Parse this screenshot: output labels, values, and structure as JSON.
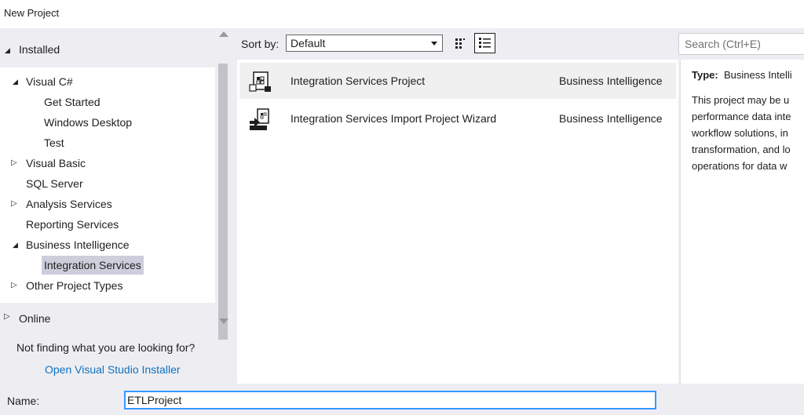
{
  "window": {
    "title": "New Project"
  },
  "tree": {
    "installed_label": "Installed",
    "items": [
      {
        "label": "Visual C#",
        "expanded": true
      },
      {
        "label": "Get Started"
      },
      {
        "label": "Windows Desktop"
      },
      {
        "label": "Test"
      },
      {
        "label": "Visual Basic",
        "expanded": false
      },
      {
        "label": "SQL Server"
      },
      {
        "label": "Analysis Services",
        "expanded": false
      },
      {
        "label": "Reporting Services"
      },
      {
        "label": "Business Intelligence",
        "expanded": true
      },
      {
        "label": "Integration Services",
        "selected": true
      },
      {
        "label": "Other Project Types",
        "expanded": false
      }
    ],
    "online_label": "Online",
    "not_finding": "Not finding what you are looking for?",
    "installer_link": "Open Visual Studio Installer"
  },
  "toolbar": {
    "sort_label": "Sort by:",
    "sort_value": "Default"
  },
  "templates": [
    {
      "name": "Integration Services Project",
      "category": "Business Intelligence",
      "selected": true
    },
    {
      "name": "Integration Services Import Project Wizard",
      "category": "Business Intelligence"
    }
  ],
  "search": {
    "placeholder": "Search (Ctrl+E)"
  },
  "details": {
    "type_label": "Type:",
    "type_value": "Business Intelli",
    "description_lines": [
      "This project may be u",
      "performance data inte",
      "workflow solutions, in",
      "transformation, and lo",
      "operations for data w"
    ]
  },
  "name_field": {
    "label": "Name:",
    "value": "ETLProject"
  },
  "colors": {
    "selection": "#cccedb",
    "link": "#0e70c0",
    "focus_border": "#3399ff"
  }
}
